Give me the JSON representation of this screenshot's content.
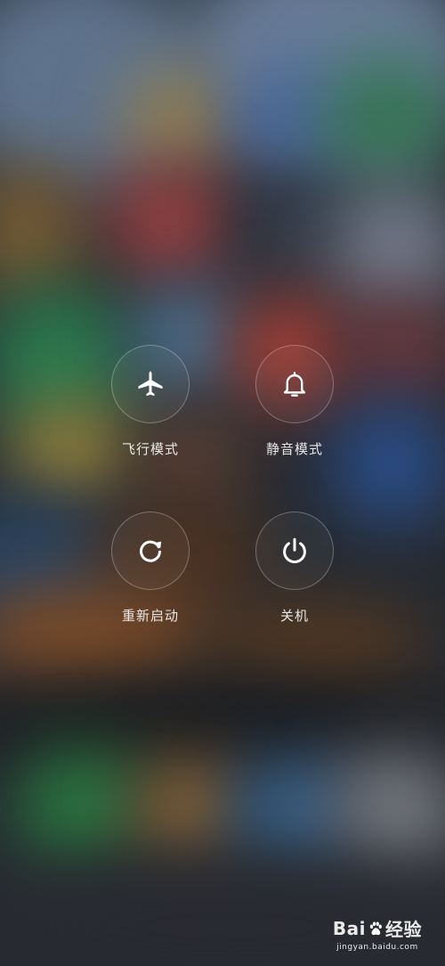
{
  "power_menu": {
    "airplane_mode_label": "飞行模式",
    "silent_mode_label": "静音模式",
    "restart_label": "重新启动",
    "power_off_label": "关机"
  },
  "icons": {
    "airplane_mode": "airplane-icon",
    "silent_mode": "bell-icon",
    "restart": "restart-icon",
    "power_off": "power-icon"
  },
  "watermark": {
    "logo_text_left": "Bai",
    "logo_text_right": "经验",
    "site": "jingyan.baidu.com"
  },
  "colors": {
    "icon": "#ffffff",
    "label": "#e0e0e0",
    "button_border": "#8a8d92"
  }
}
